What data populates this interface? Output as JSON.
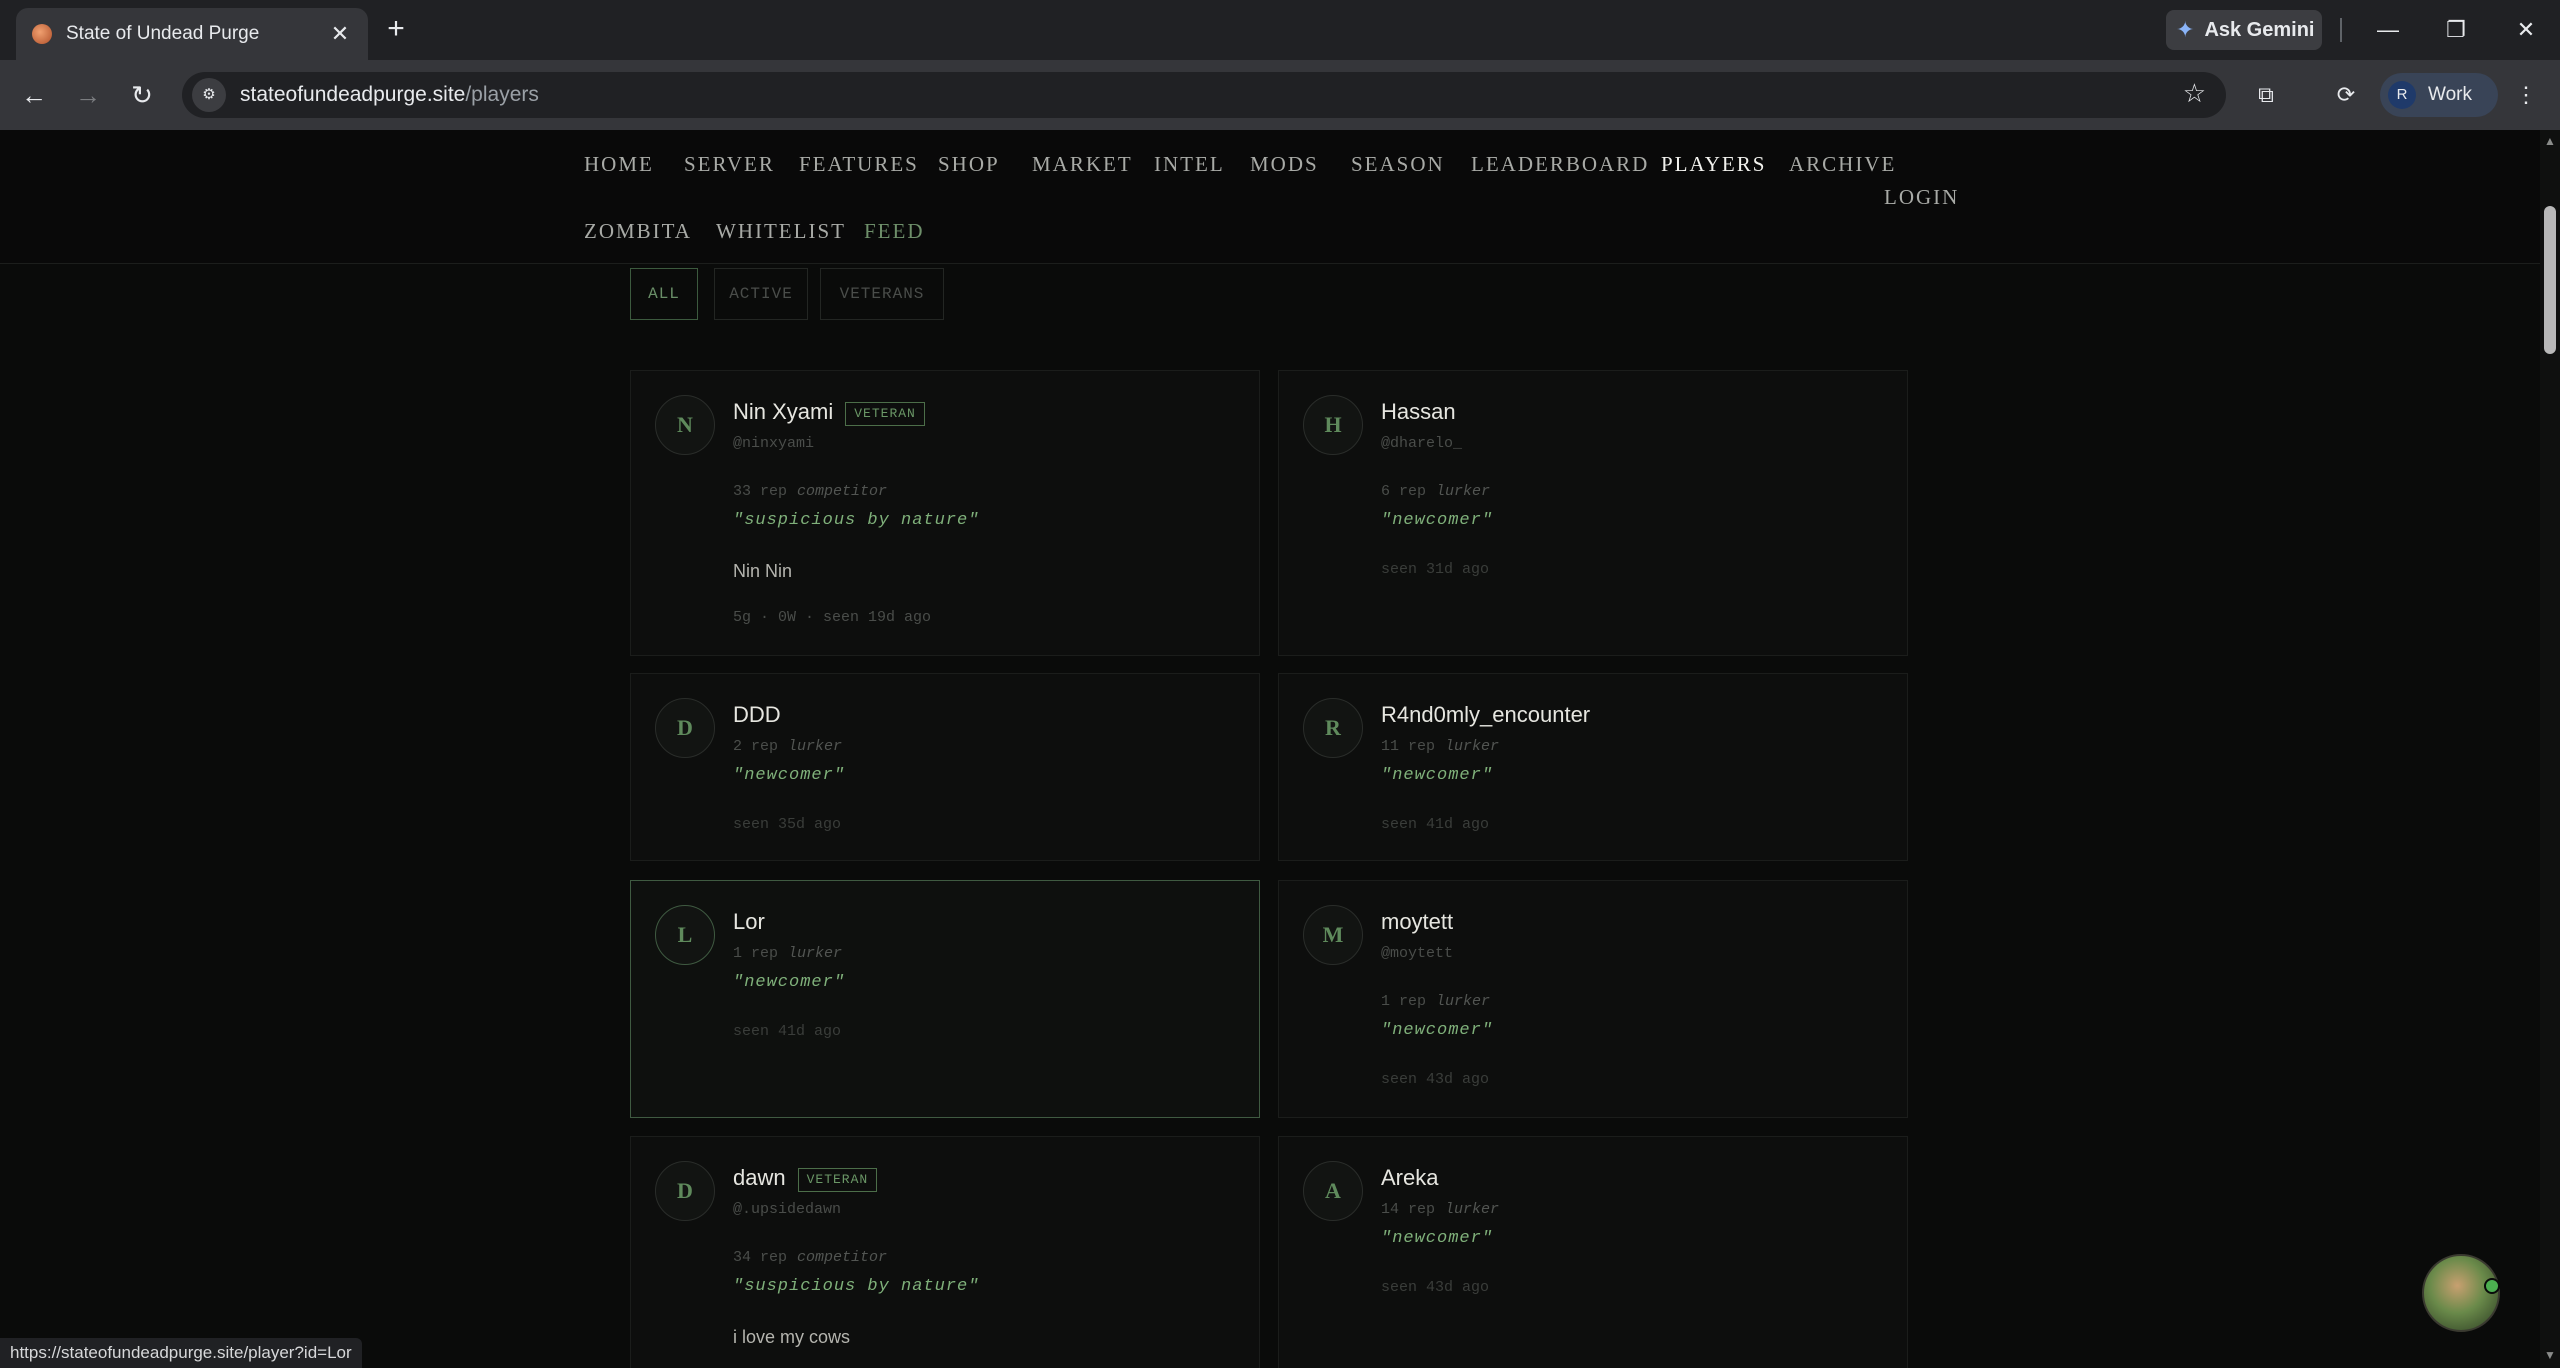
{
  "browser": {
    "tab_title": "State of Undead Purge",
    "tab_close": "✕",
    "new_tab": "+",
    "ask_gemini": "Ask Gemini",
    "url_host": "stateofundeadpurge.site",
    "url_path": "/players",
    "profile_initial": "R",
    "profile_label": "Work",
    "status_url": "https://stateofundeadpurge.site/player?id=Lor"
  },
  "nav": {
    "home": "HOME",
    "server": "SERVER",
    "features": "FEATURES",
    "shop": "SHOP",
    "market": "MARKET",
    "intel": "INTEL",
    "mods": "MODS",
    "season": "SEASON",
    "leaderboard": "LEADERBOARD",
    "players": "PLAYERS",
    "archive": "ARCHIVE",
    "login": "LOGIN",
    "zombita": "ZOMBITA",
    "whitelist": "WHITELIST",
    "feed": "FEED",
    "active_item": "PLAYERS"
  },
  "filters": {
    "all": "ALL",
    "active": "ACTIVE",
    "veterans": "VETERANS",
    "selected": "ALL"
  },
  "players": [
    {
      "initial": "N",
      "name": "Nin Xyami",
      "badge": "VETERAN",
      "handle": "@ninxyami",
      "rep": "33 rep",
      "role": "competitor",
      "quote": "\"suspicious by nature\"",
      "bio": "Nin Nin",
      "meta": "5g · 0W · seen 19d ago"
    },
    {
      "initial": "H",
      "name": "Hassan",
      "handle": "@dharelo_",
      "rep": "6 rep",
      "role": "lurker",
      "quote": "\"newcomer\"",
      "seen": "seen 31d ago"
    },
    {
      "initial": "D",
      "name": "DDD",
      "rep": "2 rep",
      "role": "lurker",
      "quote": "\"newcomer\"",
      "seen": "seen 35d ago"
    },
    {
      "initial": "R",
      "name": "R4nd0mly_encounter",
      "rep": "11 rep",
      "role": "lurker",
      "quote": "\"newcomer\"",
      "seen": "seen 41d ago"
    },
    {
      "initial": "L",
      "name": "Lor",
      "rep": "1 rep",
      "role": "lurker",
      "quote": "\"newcomer\"",
      "seen": "seen 41d ago"
    },
    {
      "initial": "M",
      "name": "moytett",
      "handle": "@moytett",
      "rep": "1 rep",
      "role": "lurker",
      "quote": "\"newcomer\"",
      "seen": "seen 43d ago"
    },
    {
      "initial": "D",
      "name": "dawn",
      "badge": "VETERAN",
      "handle": "@.upsidedawn",
      "rep": "34 rep",
      "role": "competitor",
      "quote": "\"suspicious by nature\"",
      "bio": "i love my cows"
    },
    {
      "initial": "A",
      "name": "Areka",
      "rep": "14 rep",
      "role": "lurker",
      "quote": "\"newcomer\"",
      "seen": "seen 43d ago"
    }
  ],
  "icons": {
    "back": "back-arrow-icon",
    "forward": "forward-arrow-icon",
    "reload": "reload-icon",
    "bookmark": "star-icon",
    "menu": "kebab-menu-icon"
  },
  "colors": {
    "accent_green": "#7fb07a",
    "page_bg": "#0a0b0a",
    "card_border_hover": "#3f5a41"
  }
}
